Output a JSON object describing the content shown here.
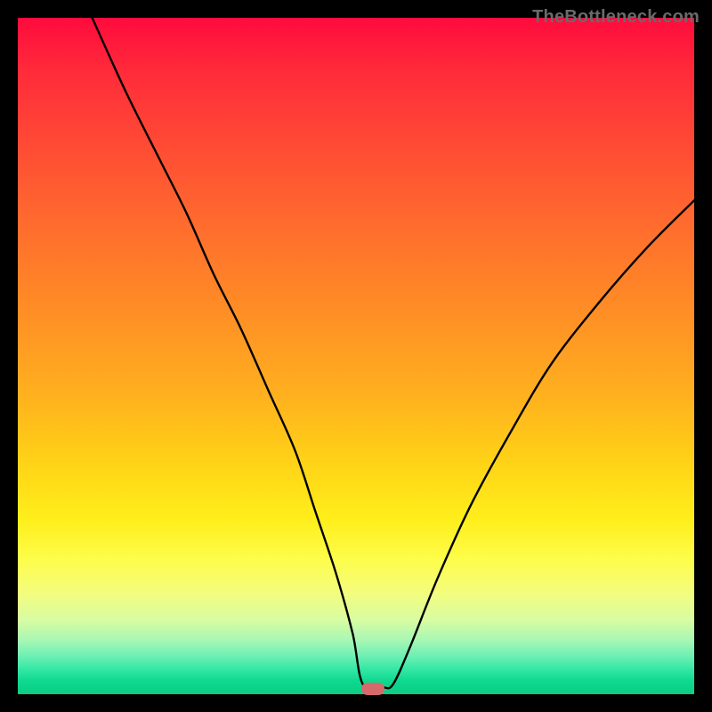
{
  "watermark": "TheBottleneck.com",
  "marker": {
    "cx_pct": 52.5,
    "cy_pct": 99.2
  },
  "chart_data": {
    "type": "line",
    "title": "",
    "xlabel": "",
    "ylabel": "",
    "xlim": [
      0,
      100
    ],
    "ylim": [
      0,
      100
    ],
    "grid": false,
    "series": [
      {
        "name": "bottleneck-curve",
        "x": [
          11,
          16,
          21,
          25,
          29,
          33,
          37,
          41,
          44,
          47,
          49.5,
          51,
          54,
          55.5,
          58,
          62,
          67,
          73,
          79,
          86,
          93,
          100
        ],
        "y": [
          100,
          89,
          79,
          71,
          62,
          54,
          45,
          36,
          27,
          18,
          9,
          1.5,
          1.0,
          1.5,
          7,
          17,
          28,
          39,
          49,
          58,
          66,
          73
        ]
      }
    ],
    "gradient_stops": [
      {
        "pct": 0,
        "color": "#ff0b3d"
      },
      {
        "pct": 18,
        "color": "#ff4835"
      },
      {
        "pct": 42,
        "color": "#ff8a26"
      },
      {
        "pct": 65,
        "color": "#ffd017"
      },
      {
        "pct": 80,
        "color": "#fdfd4a"
      },
      {
        "pct": 92,
        "color": "#a8f7b4"
      },
      {
        "pct": 100,
        "color": "#0bcd82"
      }
    ],
    "marker": {
      "x": 52.5,
      "y": 0.8,
      "color": "#d66a6b"
    }
  }
}
